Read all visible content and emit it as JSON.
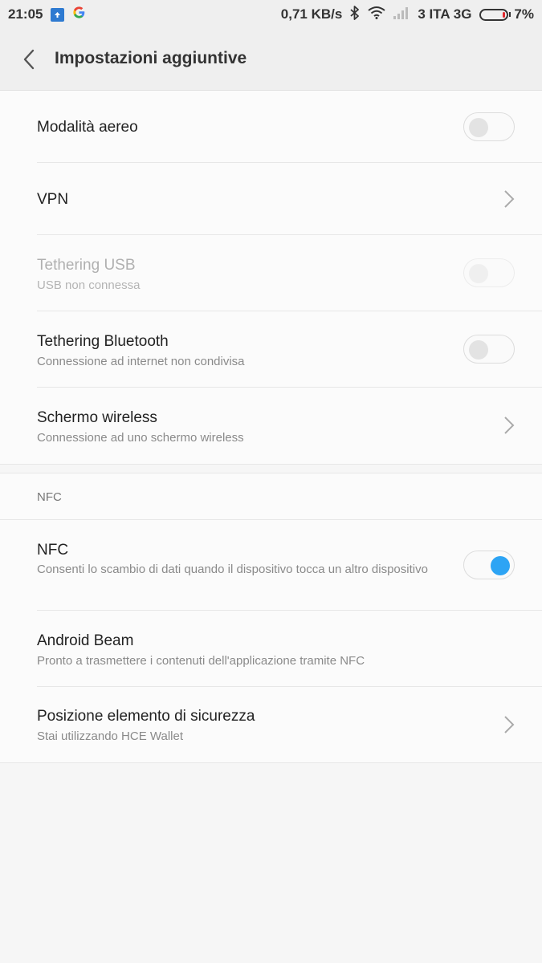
{
  "status_bar": {
    "time": "21:05",
    "net_speed": "0,71 KB/s",
    "carrier": "3 ITA 3G",
    "battery": "7%",
    "icons": [
      "upload-notification-icon",
      "google-icon",
      "bluetooth-icon",
      "wifi-icon",
      "signal-icon",
      "battery-icon"
    ]
  },
  "header": {
    "title": "Impostazioni aggiuntive",
    "back_icon": "chevron-left-icon"
  },
  "section1": {
    "rows": [
      {
        "title": "Modalità aereo",
        "control": "toggle",
        "state": "off"
      },
      {
        "title": "VPN",
        "control": "chevron"
      },
      {
        "title": "Tethering USB",
        "subtitle": "USB non connessa",
        "control": "toggle",
        "state": "off",
        "disabled": true
      },
      {
        "title": "Tethering Bluetooth",
        "subtitle": "Connessione ad internet non condivisa",
        "control": "toggle",
        "state": "off"
      },
      {
        "title": "Schermo wireless",
        "subtitle": "Connessione ad uno schermo wireless",
        "control": "chevron"
      }
    ]
  },
  "section2": {
    "label": "NFC",
    "rows": [
      {
        "title": "NFC",
        "subtitle": "Consenti lo scambio di dati quando il dispositivo tocca un altro dispositivo",
        "control": "toggle",
        "state": "on"
      },
      {
        "title": "Android Beam",
        "subtitle": "Pronto a trasmettere i contenuti dell'applicazione tramite NFC"
      },
      {
        "title": "Posizione elemento di sicurezza",
        "subtitle": "Stai utilizzando HCE Wallet",
        "control": "chevron"
      }
    ]
  },
  "colors": {
    "toggle_on": "#2da4f4",
    "battery_low": "#e0282d",
    "background": "#f6f6f6"
  }
}
